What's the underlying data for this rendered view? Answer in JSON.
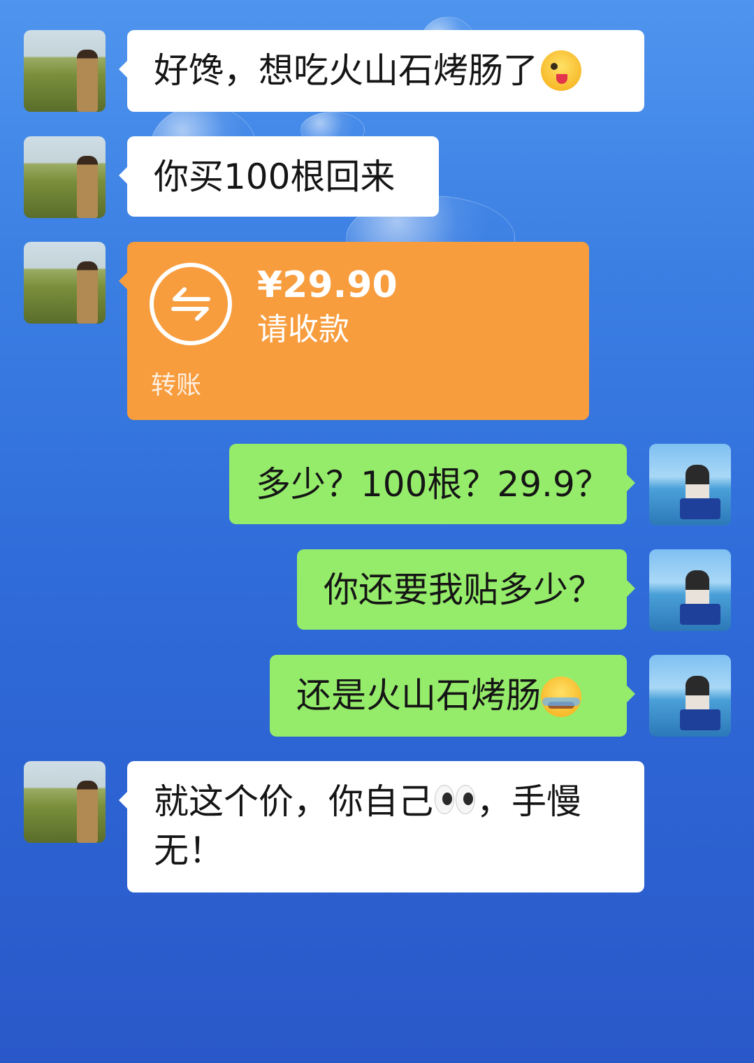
{
  "messages": [
    {
      "side": "left",
      "text": "好馋，想吃火山石烤肠了",
      "emoji": "winking-face-with-tongue-emoji"
    },
    {
      "side": "left",
      "text": "你买100根回来"
    },
    {
      "side": "left",
      "type": "transfer",
      "amount": "¥29.90",
      "status": "请收款",
      "label": "转账",
      "icon": "transfer-arrows-icon"
    },
    {
      "side": "right",
      "text": "多少？100根？29.9？"
    },
    {
      "side": "right",
      "text": "你还要我贴多少？"
    },
    {
      "side": "right",
      "text": "还是火山石烤肠",
      "emoji": "tired-crying-face-emoji"
    },
    {
      "side": "left",
      "text_part1": "就这个价，你自己",
      "emoji": "eyes-emoji",
      "text_part2": "，手慢无！"
    }
  ],
  "colors": {
    "background_top": "#4f95ee",
    "background_bottom": "#2a58c9",
    "incoming_bubble": "#ffffff",
    "outgoing_bubble": "#95ec6a",
    "transfer_card": "#f79d3e"
  }
}
